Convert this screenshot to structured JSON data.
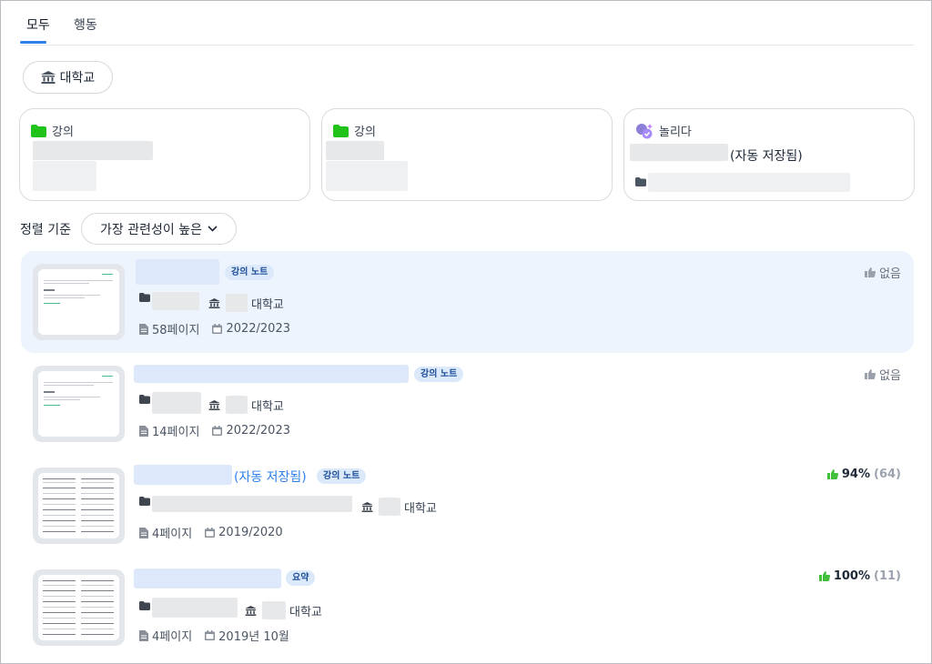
{
  "tabs": [
    {
      "label": "모두",
      "active": true
    },
    {
      "label": "행동",
      "active": false
    }
  ],
  "filter_chip": {
    "label": "대학교",
    "icon": "university-icon"
  },
  "cards": [
    {
      "icon": "folder-icon",
      "label": "강의"
    },
    {
      "icon": "folder-icon",
      "label": "강의"
    },
    {
      "icon": "sparkle-badge-icon",
      "label": "놀리다",
      "saved_text": "(자동 저장됨)"
    }
  ],
  "sort": {
    "label": "정렬 기준",
    "value": "가장 관련성이 높은"
  },
  "results": [
    {
      "badge": "강의 노트",
      "title_suffix": "",
      "university": "대학교",
      "pages": "58페이지",
      "date": "2022/2023",
      "vote_label": "없음",
      "vote_percent": "",
      "vote_count": "",
      "highlighted": true
    },
    {
      "badge": "강의 노트",
      "title_suffix": "",
      "university": "대학교",
      "pages": "14페이지",
      "date": "2022/2023",
      "vote_label": "없음",
      "vote_percent": "",
      "vote_count": "",
      "highlighted": false
    },
    {
      "badge": "강의 노트",
      "title_suffix": "(자동 저장됨)",
      "university": "대학교",
      "pages": "4페이지",
      "date": "2019/2020",
      "vote_label": "",
      "vote_percent": "94%",
      "vote_count": "(64)",
      "highlighted": false
    },
    {
      "badge": "요약",
      "title_suffix": "",
      "university": "대학교",
      "pages": "4페이지",
      "date": "2019년 10월",
      "vote_label": "",
      "vote_percent": "100%",
      "vote_count": "(11)",
      "highlighted": false
    }
  ],
  "colors": {
    "accent": "#2f80ed",
    "folder": "#21c21a",
    "thumb_up_green": "#3fbf3a",
    "thumb_up_gray": "#9aa1aa",
    "highlight": "#edf4fd"
  }
}
